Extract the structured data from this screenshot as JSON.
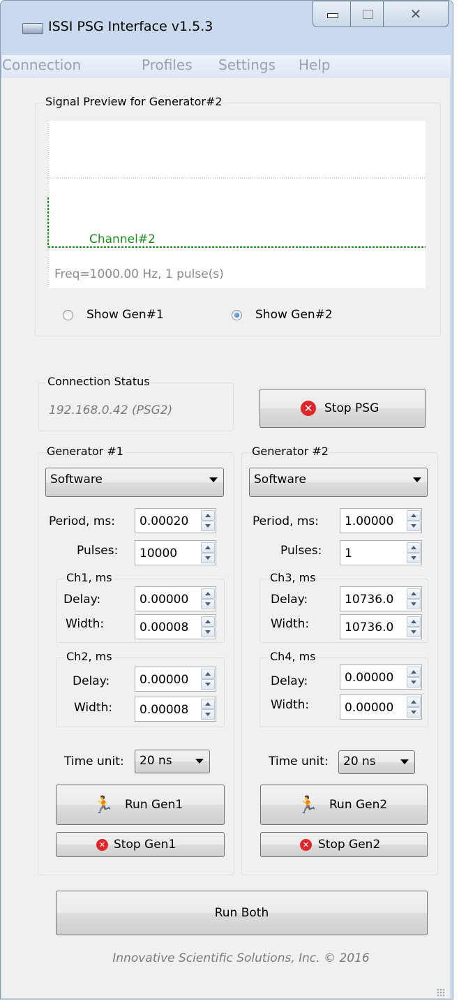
{
  "window": {
    "title": "ISSI PSG Interface v1.5.3",
    "close_glyph": "✕"
  },
  "menu": [
    "Connection",
    "Profiles",
    "Settings",
    "Help"
  ],
  "preview": {
    "title": "Signal Preview for Generator#2",
    "channel_label": "Channel#2",
    "freq_label": "Freq=1000.00 Hz, 1 pulse(s)",
    "trace_color": "#1a8f1a",
    "show_gen1": "Show Gen#1",
    "show_gen2": "Show Gen#2",
    "selected": "gen2"
  },
  "connection": {
    "title": "Connection Status",
    "status": "192.168.0.42 (PSG2)",
    "stop_psg": "Stop PSG"
  },
  "gen1": {
    "title": "Generator #1",
    "mode": "Software",
    "period_label": "Period, ms:",
    "period": "0.00020",
    "pulses_label": "Pulses:",
    "pulses": "10000",
    "chA_title": "Ch1, ms",
    "chA_delay_label": "Delay:",
    "chA_delay": "0.00000",
    "chA_width_label": "Width:",
    "chA_width": "0.00008",
    "chB_title": "Ch2, ms",
    "chB_delay_label": "Delay:",
    "chB_delay": "0.00000",
    "chB_width_label": "Width:",
    "chB_width": "0.00008",
    "time_unit_label": "Time unit:",
    "time_unit": "20 ns",
    "run": "Run Gen1",
    "stop": "Stop Gen1"
  },
  "gen2": {
    "title": "Generator #2",
    "mode": "Software",
    "period_label": "Period, ms:",
    "period": "1.00000",
    "pulses_label": "Pulses:",
    "pulses": "1",
    "chA_title": "Ch3, ms",
    "chA_delay_label": "Delay:",
    "chA_delay": "10736.0",
    "chA_width_label": "Width:",
    "chA_width": "10736.0",
    "chB_title": "Ch4, ms",
    "chB_delay_label": "Delay:",
    "chB_delay": "0.00000",
    "chB_width_label": "Width:",
    "chB_width": "0.00000",
    "time_unit_label": "Time unit:",
    "time_unit": "20 ns",
    "run": "Run Gen2",
    "stop": "Stop Gen2"
  },
  "run_both": "Run Both",
  "footer": "Innovative Scientific Solutions, Inc. © 2016",
  "colors": {
    "stop_red": "#e0262b",
    "run_green": "#3cb034"
  }
}
